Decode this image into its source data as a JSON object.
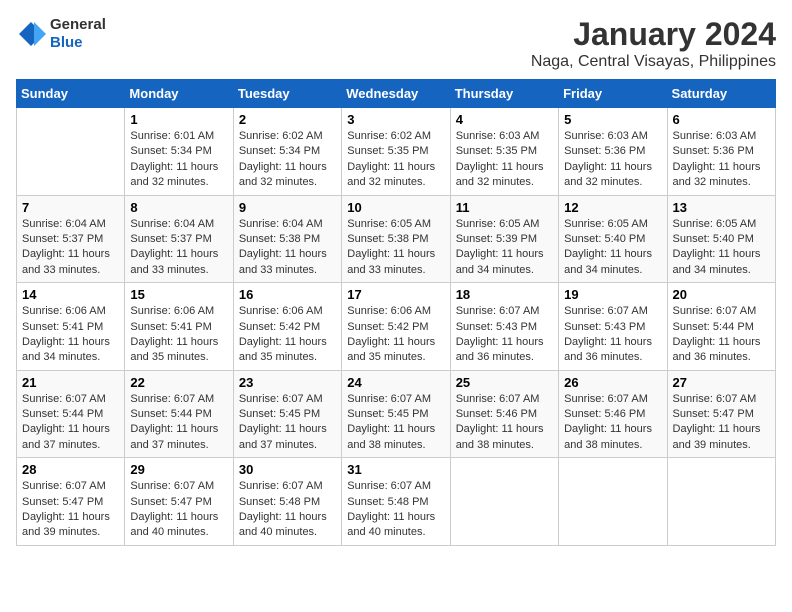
{
  "logo": {
    "general": "General",
    "blue": "Blue"
  },
  "title": "January 2024",
  "subtitle": "Naga, Central Visayas, Philippines",
  "days_of_week": [
    "Sunday",
    "Monday",
    "Tuesday",
    "Wednesday",
    "Thursday",
    "Friday",
    "Saturday"
  ],
  "weeks": [
    [
      {
        "day": "",
        "sunrise": "",
        "sunset": "",
        "daylight": ""
      },
      {
        "day": "1",
        "sunrise": "6:01 AM",
        "sunset": "5:34 PM",
        "daylight": "11 hours and 32 minutes."
      },
      {
        "day": "2",
        "sunrise": "6:02 AM",
        "sunset": "5:34 PM",
        "daylight": "11 hours and 32 minutes."
      },
      {
        "day": "3",
        "sunrise": "6:02 AM",
        "sunset": "5:35 PM",
        "daylight": "11 hours and 32 minutes."
      },
      {
        "day": "4",
        "sunrise": "6:03 AM",
        "sunset": "5:35 PM",
        "daylight": "11 hours and 32 minutes."
      },
      {
        "day": "5",
        "sunrise": "6:03 AM",
        "sunset": "5:36 PM",
        "daylight": "11 hours and 32 minutes."
      },
      {
        "day": "6",
        "sunrise": "6:03 AM",
        "sunset": "5:36 PM",
        "daylight": "11 hours and 32 minutes."
      }
    ],
    [
      {
        "day": "7",
        "sunrise": "6:04 AM",
        "sunset": "5:37 PM",
        "daylight": "11 hours and 33 minutes."
      },
      {
        "day": "8",
        "sunrise": "6:04 AM",
        "sunset": "5:37 PM",
        "daylight": "11 hours and 33 minutes."
      },
      {
        "day": "9",
        "sunrise": "6:04 AM",
        "sunset": "5:38 PM",
        "daylight": "11 hours and 33 minutes."
      },
      {
        "day": "10",
        "sunrise": "6:05 AM",
        "sunset": "5:38 PM",
        "daylight": "11 hours and 33 minutes."
      },
      {
        "day": "11",
        "sunrise": "6:05 AM",
        "sunset": "5:39 PM",
        "daylight": "11 hours and 34 minutes."
      },
      {
        "day": "12",
        "sunrise": "6:05 AM",
        "sunset": "5:40 PM",
        "daylight": "11 hours and 34 minutes."
      },
      {
        "day": "13",
        "sunrise": "6:05 AM",
        "sunset": "5:40 PM",
        "daylight": "11 hours and 34 minutes."
      }
    ],
    [
      {
        "day": "14",
        "sunrise": "6:06 AM",
        "sunset": "5:41 PM",
        "daylight": "11 hours and 34 minutes."
      },
      {
        "day": "15",
        "sunrise": "6:06 AM",
        "sunset": "5:41 PM",
        "daylight": "11 hours and 35 minutes."
      },
      {
        "day": "16",
        "sunrise": "6:06 AM",
        "sunset": "5:42 PM",
        "daylight": "11 hours and 35 minutes."
      },
      {
        "day": "17",
        "sunrise": "6:06 AM",
        "sunset": "5:42 PM",
        "daylight": "11 hours and 35 minutes."
      },
      {
        "day": "18",
        "sunrise": "6:07 AM",
        "sunset": "5:43 PM",
        "daylight": "11 hours and 36 minutes."
      },
      {
        "day": "19",
        "sunrise": "6:07 AM",
        "sunset": "5:43 PM",
        "daylight": "11 hours and 36 minutes."
      },
      {
        "day": "20",
        "sunrise": "6:07 AM",
        "sunset": "5:44 PM",
        "daylight": "11 hours and 36 minutes."
      }
    ],
    [
      {
        "day": "21",
        "sunrise": "6:07 AM",
        "sunset": "5:44 PM",
        "daylight": "11 hours and 37 minutes."
      },
      {
        "day": "22",
        "sunrise": "6:07 AM",
        "sunset": "5:44 PM",
        "daylight": "11 hours and 37 minutes."
      },
      {
        "day": "23",
        "sunrise": "6:07 AM",
        "sunset": "5:45 PM",
        "daylight": "11 hours and 37 minutes."
      },
      {
        "day": "24",
        "sunrise": "6:07 AM",
        "sunset": "5:45 PM",
        "daylight": "11 hours and 38 minutes."
      },
      {
        "day": "25",
        "sunrise": "6:07 AM",
        "sunset": "5:46 PM",
        "daylight": "11 hours and 38 minutes."
      },
      {
        "day": "26",
        "sunrise": "6:07 AM",
        "sunset": "5:46 PM",
        "daylight": "11 hours and 38 minutes."
      },
      {
        "day": "27",
        "sunrise": "6:07 AM",
        "sunset": "5:47 PM",
        "daylight": "11 hours and 39 minutes."
      }
    ],
    [
      {
        "day": "28",
        "sunrise": "6:07 AM",
        "sunset": "5:47 PM",
        "daylight": "11 hours and 39 minutes."
      },
      {
        "day": "29",
        "sunrise": "6:07 AM",
        "sunset": "5:47 PM",
        "daylight": "11 hours and 40 minutes."
      },
      {
        "day": "30",
        "sunrise": "6:07 AM",
        "sunset": "5:48 PM",
        "daylight": "11 hours and 40 minutes."
      },
      {
        "day": "31",
        "sunrise": "6:07 AM",
        "sunset": "5:48 PM",
        "daylight": "11 hours and 40 minutes."
      },
      {
        "day": "",
        "sunrise": "",
        "sunset": "",
        "daylight": ""
      },
      {
        "day": "",
        "sunrise": "",
        "sunset": "",
        "daylight": ""
      },
      {
        "day": "",
        "sunrise": "",
        "sunset": "",
        "daylight": ""
      }
    ]
  ]
}
